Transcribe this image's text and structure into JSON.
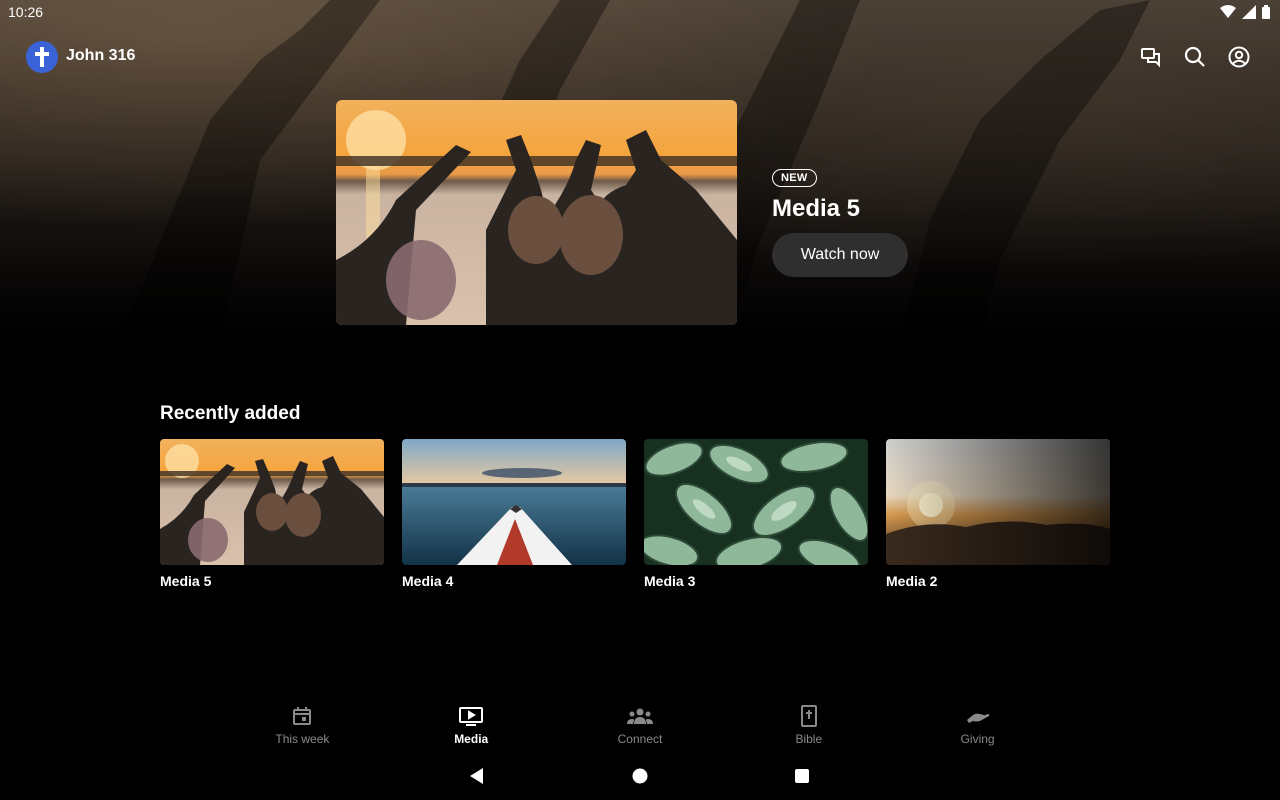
{
  "status_bar": {
    "time": "10:26"
  },
  "app": {
    "title": "John 316",
    "logo_icon": "cross-icon",
    "accent_color": "#3b63d8"
  },
  "top_actions": [
    {
      "icon": "chat-icon"
    },
    {
      "icon": "search-icon"
    },
    {
      "icon": "account-icon"
    }
  ],
  "featured": {
    "badge": "NEW",
    "title": "Media 5",
    "button_label": "Watch now"
  },
  "recently_added": {
    "title": "Recently added",
    "items": [
      {
        "label": "Media 5",
        "thumbnail": "sunset-friends-hearts"
      },
      {
        "label": "Media 4",
        "thumbnail": "kayak-on-lake"
      },
      {
        "label": "Media 3",
        "thumbnail": "green-leaves"
      },
      {
        "label": "Media 2",
        "thumbnail": "sunrise-over-clouds"
      }
    ]
  },
  "bottom_nav": {
    "items": [
      {
        "label": "This week",
        "icon": "calendar-icon",
        "active": false
      },
      {
        "label": "Media",
        "icon": "play-screen-icon",
        "active": true
      },
      {
        "label": "Connect",
        "icon": "group-icon",
        "active": false
      },
      {
        "label": "Bible",
        "icon": "bible-icon",
        "active": false
      },
      {
        "label": "Giving",
        "icon": "giving-hand-icon",
        "active": false
      }
    ]
  },
  "system_nav": [
    {
      "icon": "back-triangle-icon"
    },
    {
      "icon": "home-circle-icon"
    },
    {
      "icon": "recents-square-icon"
    }
  ]
}
